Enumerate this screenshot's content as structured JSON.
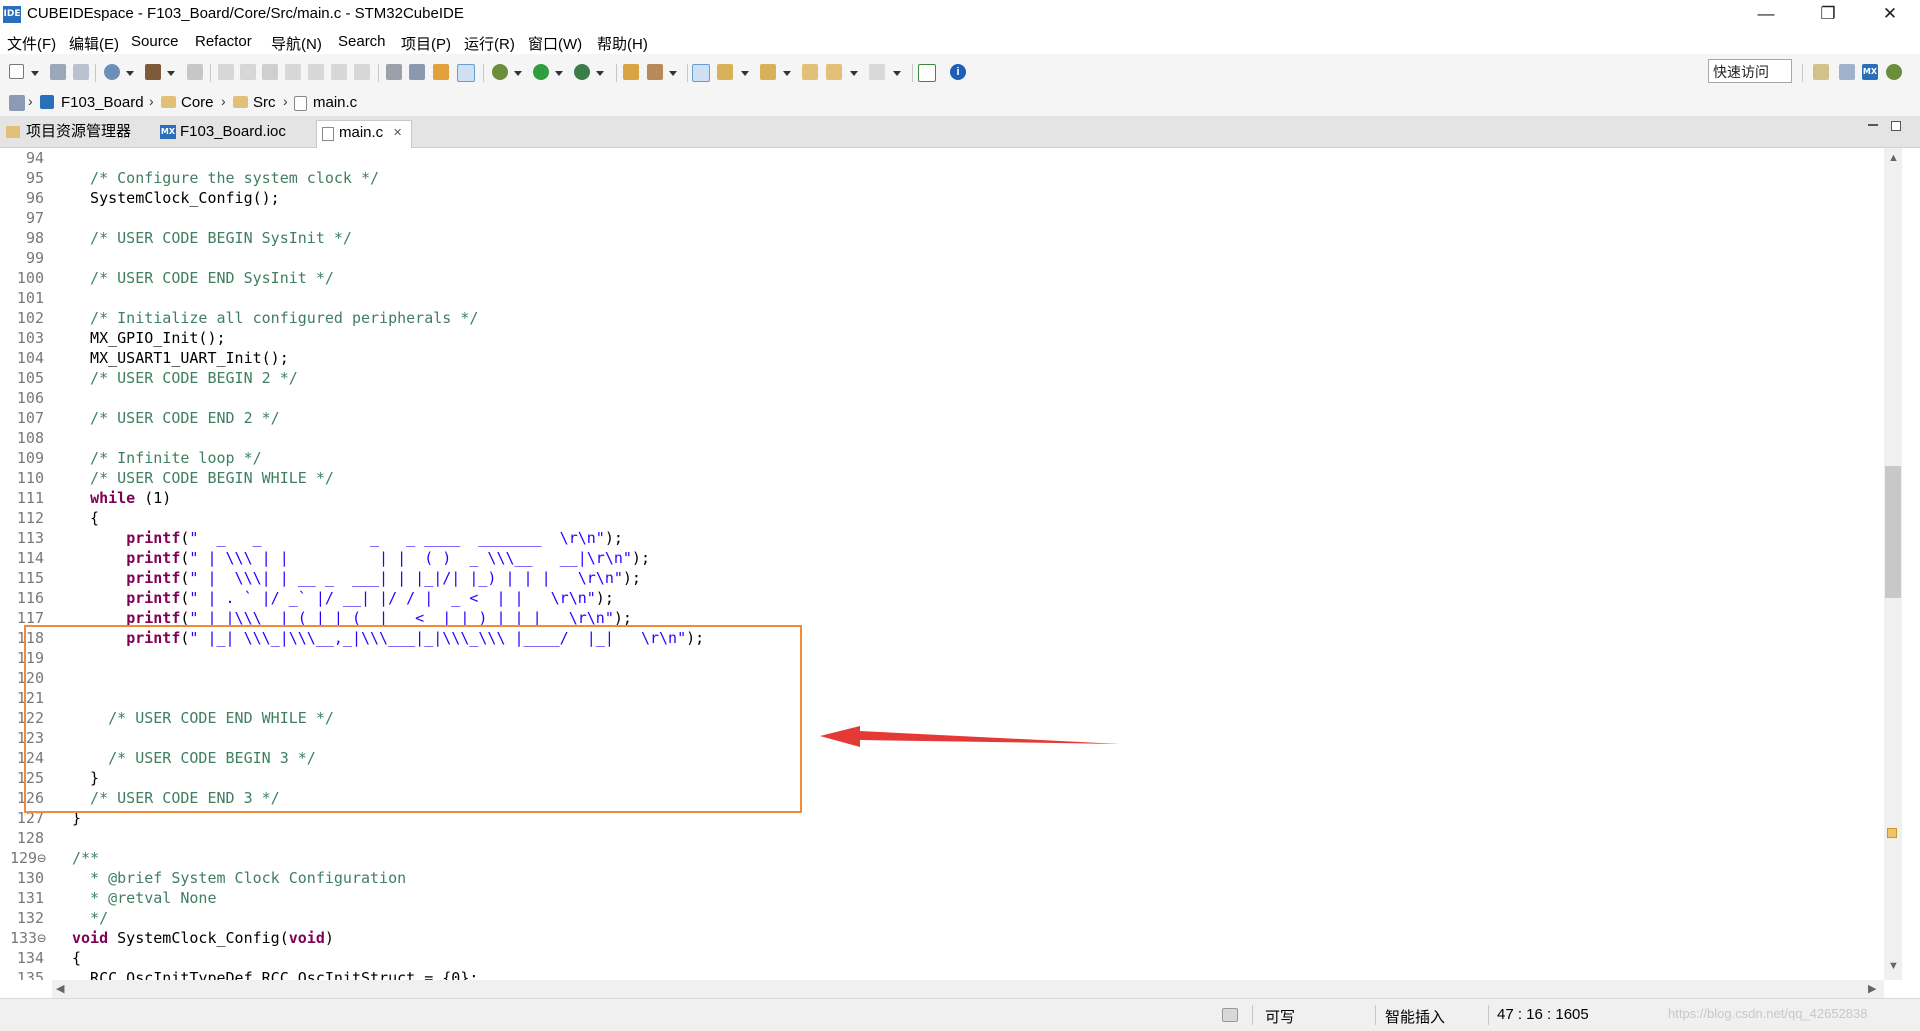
{
  "window": {
    "app_icon_label": "IDE",
    "title": "CUBEIDEspace - F103_Board/Core/Src/main.c - STM32CubeIDE",
    "min_glyph": "—",
    "restore_glyph": "❐",
    "close_glyph": "✕"
  },
  "menu": [
    "文件(F)",
    "编辑(E)",
    "Source",
    "Refactor",
    "导航(N)",
    "Search",
    "项目(P)",
    "运行(R)",
    "窗口(W)",
    "帮助(H)"
  ],
  "toolbar": {
    "quick_access_placeholder": "快速访问",
    "info_glyph": "i",
    "mx_label": "MX"
  },
  "breadcrumb": [
    "F103_Board",
    "Core",
    "Src",
    "main.c"
  ],
  "tabs": [
    {
      "label": "项目资源管理器",
      "icon": "project-explorer-icon"
    },
    {
      "label": "F103_Board.ioc",
      "icon": "mx-icon",
      "icon_label": "MX"
    },
    {
      "label": "main.c",
      "icon": "c-file-icon",
      "close": "✕",
      "active": true
    }
  ],
  "editor": {
    "lines": [
      {
        "n": "94",
        "text": "",
        "kind": "plain"
      },
      {
        "n": "95",
        "text": "  /* Configure the system clock */",
        "kind": "comment"
      },
      {
        "n": "96",
        "text": "  SystemClock_Config();",
        "kind": "plain"
      },
      {
        "n": "97",
        "text": "",
        "kind": "plain"
      },
      {
        "n": "98",
        "text": "  /* USER CODE BEGIN SysInit */",
        "kind": "comment"
      },
      {
        "n": "99",
        "text": "",
        "kind": "plain"
      },
      {
        "n": "100",
        "text": "  /* USER CODE END SysInit */",
        "kind": "comment"
      },
      {
        "n": "101",
        "text": "",
        "kind": "plain"
      },
      {
        "n": "102",
        "text": "  /* Initialize all configured peripherals */",
        "kind": "comment"
      },
      {
        "n": "103",
        "text": "  MX_GPIO_Init();",
        "kind": "plain"
      },
      {
        "n": "104",
        "text": "  MX_USART1_UART_Init();",
        "kind": "plain"
      },
      {
        "n": "105",
        "text": "  /* USER CODE BEGIN 2 */",
        "kind": "comment"
      },
      {
        "n": "106",
        "text": "",
        "kind": "plain"
      },
      {
        "n": "107",
        "text": "  /* USER CODE END 2 */",
        "kind": "comment"
      },
      {
        "n": "108",
        "text": "",
        "kind": "plain"
      },
      {
        "n": "109",
        "text": "  /* Infinite loop */",
        "kind": "comment"
      },
      {
        "n": "110",
        "text": "  /* USER CODE BEGIN WHILE */",
        "kind": "comment"
      },
      {
        "n": "111",
        "text": "  while (1)",
        "kind": "while"
      },
      {
        "n": "112",
        "text": "  {",
        "kind": "plain"
      },
      {
        "n": "113",
        "text": "      printf(\"  _   _            _   _ ____  _______  \\r\\n\");",
        "kind": "printf"
      },
      {
        "n": "114",
        "text": "      printf(\" | \\\\\\ | |          | |  ( )  _ \\\\\\__   __|\\r\\n\");",
        "kind": "printf"
      },
      {
        "n": "115",
        "text": "      printf(\" |  \\\\\\| | __ _  ___| | |_|/| |_) | | |   \\r\\n\");",
        "kind": "printf"
      },
      {
        "n": "116",
        "text": "      printf(\" | . ` |/ _` |/ __| |/ / |  _ <  | |   \\r\\n\");",
        "kind": "printf"
      },
      {
        "n": "117",
        "text": "      printf(\" | |\\\\\\  | (_| | (__|   <  | |_) | | |   \\r\\n\");",
        "kind": "printf"
      },
      {
        "n": "118",
        "text": "      printf(\" |_| \\\\\\_|\\\\\\__,_|\\\\\\___|_|\\\\\\_\\\\\\ |____/  |_|   \\r\\n\");",
        "kind": "printf"
      },
      {
        "n": "119",
        "text": "",
        "kind": "plain"
      },
      {
        "n": "120",
        "text": "",
        "kind": "plain"
      },
      {
        "n": "121",
        "text": "",
        "kind": "plain"
      },
      {
        "n": "122",
        "text": "    /* USER CODE END WHILE */",
        "kind": "comment"
      },
      {
        "n": "123",
        "text": "",
        "kind": "plain"
      },
      {
        "n": "124",
        "text": "    /* USER CODE BEGIN 3 */",
        "kind": "comment"
      },
      {
        "n": "125",
        "text": "  }",
        "kind": "plain"
      },
      {
        "n": "126",
        "text": "  /* USER CODE END 3 */",
        "kind": "comment"
      },
      {
        "n": "127",
        "text": "}",
        "kind": "plain"
      },
      {
        "n": "128",
        "text": "",
        "kind": "plain"
      },
      {
        "n": "129⊖",
        "text": "/**",
        "kind": "comment"
      },
      {
        "n": "130",
        "text": "  * @brief System Clock Configuration",
        "kind": "comment"
      },
      {
        "n": "131",
        "text": "  * @retval None",
        "kind": "comment"
      },
      {
        "n": "132",
        "text": "  */",
        "kind": "comment"
      },
      {
        "n": "133⊖",
        "text": "void SystemClock_Config(void)",
        "kind": "funcdef"
      },
      {
        "n": "134",
        "text": "{",
        "kind": "plain"
      },
      {
        "n": "135",
        "text": "  RCC_OscInitTypeDef RCC_OscInitStruct = {0};",
        "kind": "plain"
      }
    ]
  },
  "statusbar": {
    "writable": "可写",
    "insert_mode": "智能插入",
    "position": "47 : 16 : 1605",
    "watermark": "https://blog.csdn.net/qq_42652838"
  },
  "colors": {
    "comment": "#3f7f5f",
    "keyword": "#7f0055",
    "string": "#2a00ff",
    "highlight_box": "#f28a3c",
    "annotation_arrow": "#e53935"
  }
}
